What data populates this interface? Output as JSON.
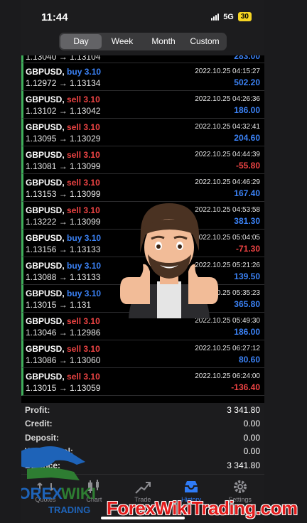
{
  "status_bar": {
    "time": "11:44",
    "network": "5G",
    "battery": "30"
  },
  "period_tabs": [
    "Day",
    "Week",
    "Month",
    "Custom"
  ],
  "active_tab": "Day",
  "partial_row": {
    "prices": "1.13040 → 1.13104",
    "profit": "283.00"
  },
  "trades": [
    {
      "symbol": "GBPUSD,",
      "side": "buy",
      "volume": "3.10",
      "datetime": "2022.10.25 04:15:27",
      "prices": "1.12972 → 1.13134",
      "profit": "502.20"
    },
    {
      "symbol": "GBPUSD,",
      "side": "sell",
      "volume": "3.10",
      "datetime": "2022.10.25 04:26:36",
      "prices": "1.13102 → 1.13042",
      "profit": "186.00"
    },
    {
      "symbol": "GBPUSD,",
      "side": "sell",
      "volume": "3.10",
      "datetime": "2022.10.25 04:32:41",
      "prices": "1.13095 → 1.13029",
      "profit": "204.60"
    },
    {
      "symbol": "GBPUSD,",
      "side": "sell",
      "volume": "3.10",
      "datetime": "2022.10.25 04:44:39",
      "prices": "1.13081 → 1.13099",
      "profit": "-55.80"
    },
    {
      "symbol": "GBPUSD,",
      "side": "sell",
      "volume": "3.10",
      "datetime": "2022.10.25 04:46:29",
      "prices": "1.13153 → 1.13099",
      "profit": "167.40"
    },
    {
      "symbol": "GBPUSD,",
      "side": "sell",
      "volume": "3.10",
      "datetime": "2022.10.25 04:53:58",
      "prices": "1.13222 → 1.13099",
      "profit": "381.30"
    },
    {
      "symbol": "GBPUSD,",
      "side": "buy",
      "volume": "3.10",
      "datetime": "2022.10.25 05:04:05",
      "prices": "1.13156 → 1.13133",
      "profit": "-71.30"
    },
    {
      "symbol": "GBPUSD,",
      "side": "buy",
      "volume": "3.10",
      "datetime": "2022.10.25 05:21:26",
      "prices": "1.13088 → 1.13133",
      "profit": "139.50"
    },
    {
      "symbol": "GBPUSD,",
      "side": "buy",
      "volume": "3.10",
      "datetime": "2022.10.25 05:35:23",
      "prices": "1.13015 → 1.131",
      "profit": "365.80"
    },
    {
      "symbol": "GBPUSD,",
      "side": "sell",
      "volume": "3.10",
      "datetime": "2022.10.25 05:49:30",
      "prices": "1.13046 → 1.12986",
      "profit": "186.00"
    },
    {
      "symbol": "GBPUSD,",
      "side": "sell",
      "volume": "3.10",
      "datetime": "2022.10.25 06:27:12",
      "prices": "1.13086 → 1.13060",
      "profit": "80.60"
    },
    {
      "symbol": "GBPUSD,",
      "side": "sell",
      "volume": "3.10",
      "datetime": "2022.10.25 06:24:00",
      "prices": "1.13015 → 1.13059",
      "profit": "-136.40"
    }
  ],
  "summary": [
    {
      "label": "Profit:",
      "value": "3 341.80"
    },
    {
      "label": "Credit:",
      "value": "0.00"
    },
    {
      "label": "Deposit:",
      "value": "0.00"
    },
    {
      "label": "Withdrawal:",
      "value": "0.00"
    },
    {
      "label": "Balance:",
      "value": "3 341.80"
    }
  ],
  "tab_bar": [
    {
      "label": "Quotes",
      "icon": "quotes-icon"
    },
    {
      "label": "Chart",
      "icon": "chart-icon"
    },
    {
      "label": "Trade",
      "icon": "trade-icon"
    },
    {
      "label": "History",
      "icon": "history-icon"
    },
    {
      "label": "Settings",
      "icon": "gear-icon"
    }
  ],
  "active_bottom_tab": "History",
  "watermark": {
    "logo_text": "FOREX WIKI TRADING",
    "url_text": "ForexWikiTrading.com"
  },
  "colors": {
    "buy": "#3b82f6",
    "sell": "#ef4444",
    "positive": "#3b82f6",
    "negative": "#ef4444",
    "row_marker": "#3fae5a",
    "accent": "#2f7bf6"
  }
}
